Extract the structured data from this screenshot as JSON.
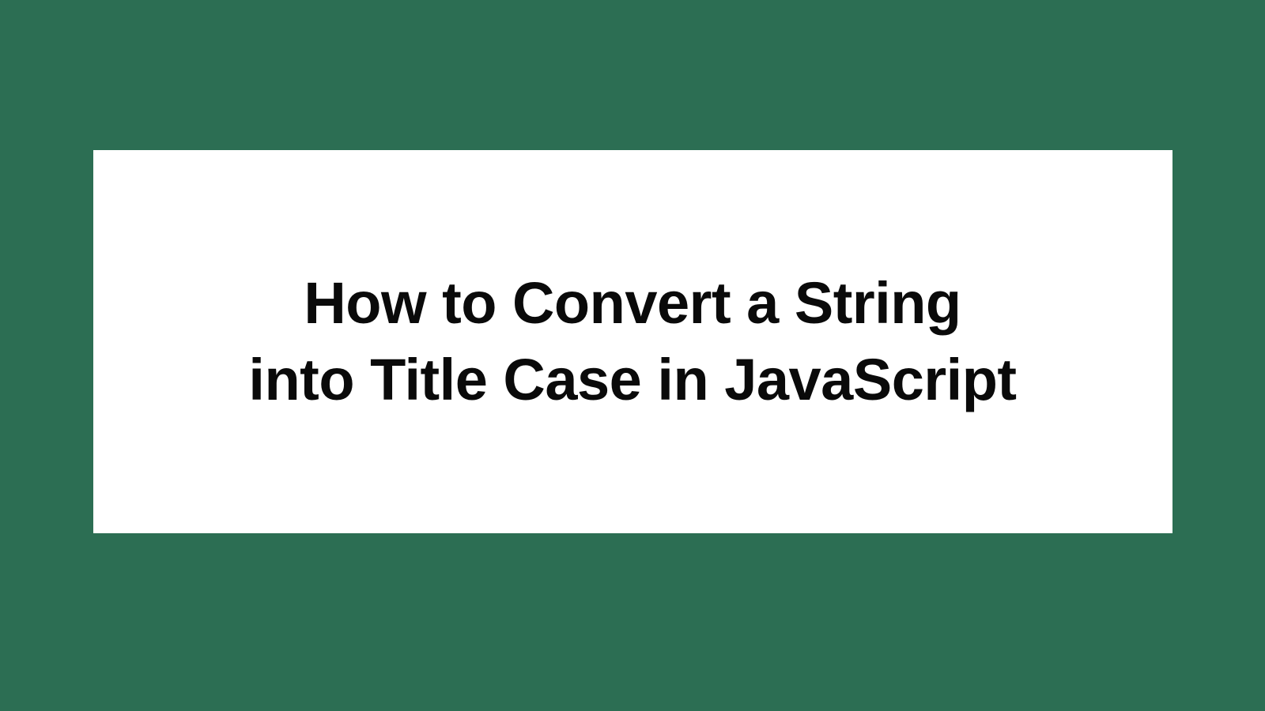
{
  "card": {
    "title_line1": "How to Convert a String",
    "title_line2": "into Title Case in JavaScript"
  },
  "colors": {
    "background": "#2c6e53",
    "card_background": "#ffffff",
    "text": "#0a0a0a"
  }
}
